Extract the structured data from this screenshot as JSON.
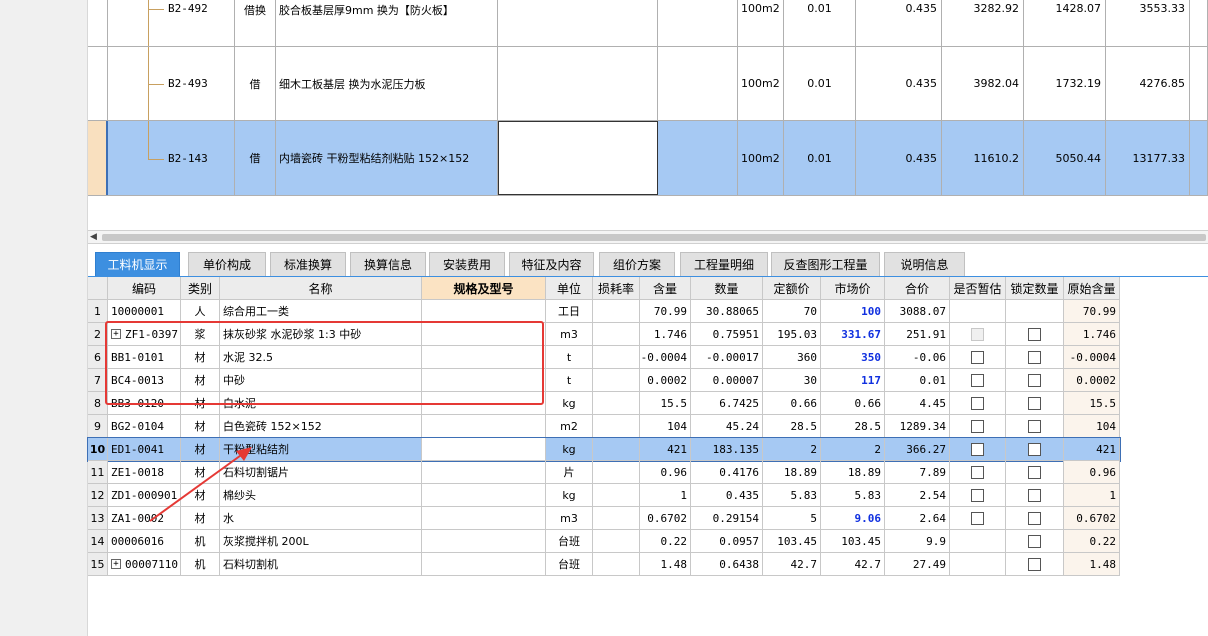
{
  "upper_rows": [
    {
      "code": "B2-492",
      "type": "借换",
      "name": "胶合板基层厚9mm  换为【防火板】",
      "unit": "100m2",
      "coef": "0.01",
      "qty": "0.435",
      "v1": "3282.92",
      "v2": "1428.07",
      "v3": "3553.33"
    },
    {
      "code": "B2-493",
      "type": "借",
      "name": "细木工板基层  换为水泥压力板",
      "unit": "100m2",
      "coef": "0.01",
      "qty": "0.435",
      "v1": "3982.04",
      "v2": "1732.19",
      "v3": "4276.85"
    },
    {
      "code": "B2-143",
      "type": "借",
      "name": "内墙瓷砖 干粉型粘结剂粘贴 152×152",
      "unit": "100m2",
      "coef": "0.01",
      "qty": "0.435",
      "v1": "11610.2",
      "v2": "5050.44",
      "v3": "13177.33"
    }
  ],
  "tabs": [
    "工料机显示",
    "单价构成",
    "标准换算",
    "换算信息",
    "安装费用",
    "特征及内容",
    "组价方案",
    "工程量明细",
    "反查图形工程量",
    "说明信息"
  ],
  "headers": {
    "code": "编码",
    "cat": "类别",
    "name": "名称",
    "spec": "规格及型号",
    "unit": "单位",
    "loss": "损耗率",
    "content": "含量",
    "qty": "数量",
    "fixed": "定额价",
    "market": "市场价",
    "total": "合价",
    "est": "是否暂估",
    "lock": "锁定数量",
    "orig": "原始含量"
  },
  "rows": [
    {
      "no": "1",
      "code": "10000001",
      "cat": "人",
      "name": "综合用工一类",
      "unit": "工日",
      "content": "70.99",
      "qty": "30.88065",
      "fixed": "70",
      "market": "100",
      "market_blue": true,
      "total": "3088.07",
      "est": "",
      "lock": "",
      "orig": "70.99"
    },
    {
      "no": "2",
      "code": "ZF1-0397",
      "expand": true,
      "cat": "浆",
      "name": "抹灰砂浆 水泥砂浆 1:3 中砂",
      "unit": "m3",
      "content": "1.746",
      "qty": "0.75951",
      "fixed": "195.03",
      "market": "331.67",
      "market_blue": true,
      "total": "251.91",
      "est": "disabled",
      "lock": "box",
      "orig": "1.746"
    },
    {
      "no": "6",
      "code": "BB1-0101",
      "cat": "材",
      "name": "水泥 32.5",
      "unit": "t",
      "content": "-0.0004",
      "qty": "-0.00017",
      "fixed": "360",
      "market": "350",
      "market_blue": true,
      "total": "-0.06",
      "est": "box",
      "lock": "box",
      "orig": "-0.0004"
    },
    {
      "no": "7",
      "code": "BC4-0013",
      "cat": "材",
      "name": "中砂",
      "unit": "t",
      "content": "0.0002",
      "qty": "0.00007",
      "fixed": "30",
      "market": "117",
      "market_blue": true,
      "total": "0.01",
      "est": "box",
      "lock": "box",
      "orig": "0.0002"
    },
    {
      "no": "8",
      "code": "BB3-0120",
      "cat": "材",
      "name": "白水泥",
      "unit": "kg",
      "content": "15.5",
      "qty": "6.7425",
      "fixed": "0.66",
      "market": "0.66",
      "market_blue": false,
      "total": "4.45",
      "est": "box",
      "lock": "box",
      "orig": "15.5"
    },
    {
      "no": "9",
      "code": "BG2-0104",
      "cat": "材",
      "name": "白色瓷砖 152×152",
      "unit": "m2",
      "content": "104",
      "qty": "45.24",
      "fixed": "28.5",
      "market": "28.5",
      "market_blue": false,
      "total": "1289.34",
      "est": "box",
      "lock": "box",
      "orig": "104"
    },
    {
      "no": "10",
      "code": "ED1-0041",
      "cat": "材",
      "name": "干粉型粘结剂",
      "unit": "kg",
      "content": "421",
      "qty": "183.135",
      "fixed": "2",
      "market": "2",
      "market_blue": false,
      "total": "366.27",
      "est": "box",
      "lock": "box",
      "orig": "421",
      "selected": true
    },
    {
      "no": "11",
      "code": "ZE1-0018",
      "cat": "材",
      "name": "石料切割锯片",
      "unit": "片",
      "content": "0.96",
      "qty": "0.4176",
      "fixed": "18.89",
      "market": "18.89",
      "market_blue": false,
      "total": "7.89",
      "est": "box",
      "lock": "box",
      "orig": "0.96"
    },
    {
      "no": "12",
      "code": "ZD1-000901",
      "cat": "材",
      "name": "棉纱头",
      "unit": "kg",
      "content": "1",
      "qty": "0.435",
      "fixed": "5.83",
      "market": "5.83",
      "market_blue": false,
      "total": "2.54",
      "est": "box",
      "lock": "box",
      "orig": "1"
    },
    {
      "no": "13",
      "code": "ZA1-0002",
      "cat": "材",
      "name": "水",
      "unit": "m3",
      "content": "0.6702",
      "qty": "0.29154",
      "fixed": "5",
      "market": "9.06",
      "market_blue": true,
      "total": "2.64",
      "est": "box",
      "lock": "box",
      "orig": "0.6702"
    },
    {
      "no": "14",
      "code": "00006016",
      "cat": "机",
      "name": "灰浆搅拌机 200L",
      "unit": "台班",
      "content": "0.22",
      "qty": "0.0957",
      "fixed": "103.45",
      "market": "103.45",
      "market_blue": false,
      "total": "9.9",
      "est": "",
      "lock": "box",
      "orig": "0.22"
    },
    {
      "no": "15",
      "code": "00007110",
      "expand": true,
      "cat": "机",
      "name": "石料切割机",
      "unit": "台班",
      "content": "1.48",
      "qty": "0.6438",
      "fixed": "42.7",
      "market": "42.7",
      "market_blue": false,
      "total": "27.49",
      "est": "",
      "lock": "box",
      "orig": "1.48"
    }
  ],
  "colors": {
    "accent": "#3d8fe0",
    "selection": "#a6c9f3",
    "annotation": "#e53935",
    "price_blue": "#1030e0"
  }
}
